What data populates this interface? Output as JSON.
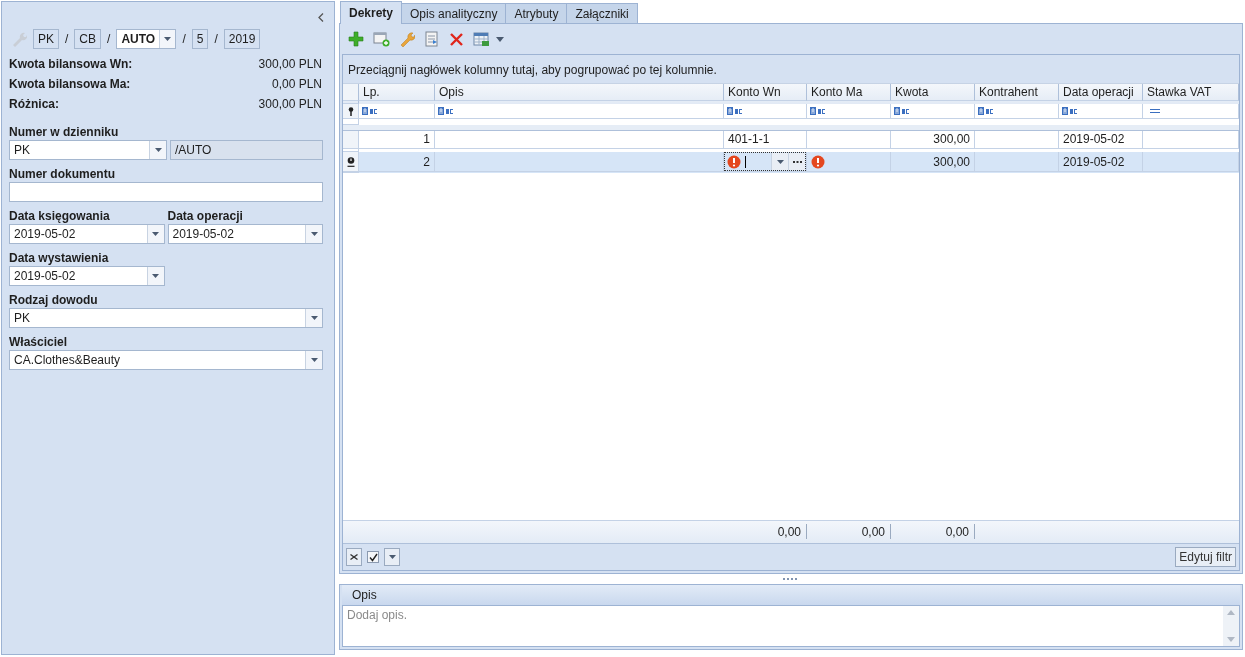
{
  "sidebar": {
    "number_parts": [
      {
        "kind": "box",
        "value": "PK"
      },
      {
        "kind": "sep",
        "value": "/"
      },
      {
        "kind": "box",
        "value": "CB"
      },
      {
        "kind": "sep",
        "value": "/"
      },
      {
        "kind": "combo",
        "value": "AUTO"
      },
      {
        "kind": "sep",
        "value": "/"
      },
      {
        "kind": "box",
        "value": "5"
      },
      {
        "kind": "sep",
        "value": "/"
      },
      {
        "kind": "box",
        "value": "2019"
      }
    ],
    "summary": [
      {
        "label": "Kwota bilansowa Wn:",
        "value": "300,00 PLN"
      },
      {
        "label": "Kwota bilansowa Ma:",
        "value": "0,00 PLN"
      },
      {
        "label": "Różnica:",
        "value": "300,00 PLN"
      }
    ],
    "fields": [
      {
        "label": "Numer w dzienniku",
        "controls": [
          {
            "kind": "combo",
            "value": "PK"
          },
          {
            "kind": "readonly",
            "value": "/AUTO"
          }
        ]
      },
      {
        "label": "Numer dokumentu",
        "controls": [
          {
            "kind": "text"
          }
        ]
      },
      {
        "label": "Data księgowania",
        "controls": [
          {
            "kind": "date",
            "value": "2019-05-02"
          }
        ]
      },
      {
        "label": "Data operacji",
        "controls": [
          {
            "kind": "date",
            "value": "2019-05-02"
          }
        ]
      },
      {
        "label": "Data wystawienia",
        "controls": [
          {
            "kind": "date",
            "value": "2019-05-02"
          }
        ]
      },
      {
        "label": "Rodzaj dowodu",
        "controls": [
          {
            "kind": "combo",
            "value": "PK"
          }
        ]
      },
      {
        "label": "Właściciel",
        "controls": [
          {
            "kind": "combo",
            "value": "CA.Clothes&Beauty"
          }
        ]
      }
    ]
  },
  "tabs": [
    {
      "label": "Dekrety",
      "selected": true
    },
    {
      "label": "Opis analityczny",
      "selected": false
    },
    {
      "label": "Atrybuty",
      "selected": false
    },
    {
      "label": "Załączniki",
      "selected": false
    }
  ],
  "grid": {
    "group_hint": "Przeciągnij nagłówek kolumny tutaj, aby pogrupować po tej kolumnie.",
    "columns": [
      {
        "label": "Lp.",
        "kind": "text"
      },
      {
        "label": "Opis",
        "kind": "text"
      },
      {
        "label": "Konto Wn",
        "kind": "text",
        "total": "0,00"
      },
      {
        "label": "Konto Ma",
        "kind": "text",
        "total": "0,00"
      },
      {
        "label": "Kwota",
        "kind": "text",
        "total": "0,00"
      },
      {
        "label": "Kontrahent",
        "kind": "text"
      },
      {
        "label": "Data operacji",
        "kind": "text"
      },
      {
        "label": "Stawka VAT",
        "kind": "number"
      }
    ],
    "rows": [
      {
        "selected": false,
        "cells": [
          {
            "kind": "text",
            "value": "1"
          },
          {
            "kind": "text"
          },
          {
            "kind": "text",
            "value": "401-1-1"
          },
          {
            "kind": "text"
          },
          {
            "kind": "text",
            "value": "300,00"
          },
          {
            "kind": "text"
          },
          {
            "kind": "text",
            "value": "2019-05-02"
          },
          {
            "kind": "text"
          }
        ]
      },
      {
        "selected": true,
        "cells": [
          {
            "kind": "text",
            "value": "2"
          },
          {
            "kind": "text"
          },
          {
            "kind": "editor_error"
          },
          {
            "kind": "error"
          },
          {
            "kind": "text",
            "value": "300,00"
          },
          {
            "kind": "text"
          },
          {
            "kind": "text",
            "value": "2019-05-02"
          },
          {
            "kind": "text"
          }
        ]
      }
    ],
    "filter_bar": {
      "enabled": true,
      "button": "Edytuj filtr"
    }
  },
  "description": {
    "title": "Opis",
    "placeholder": "Dodaj opis."
  }
}
